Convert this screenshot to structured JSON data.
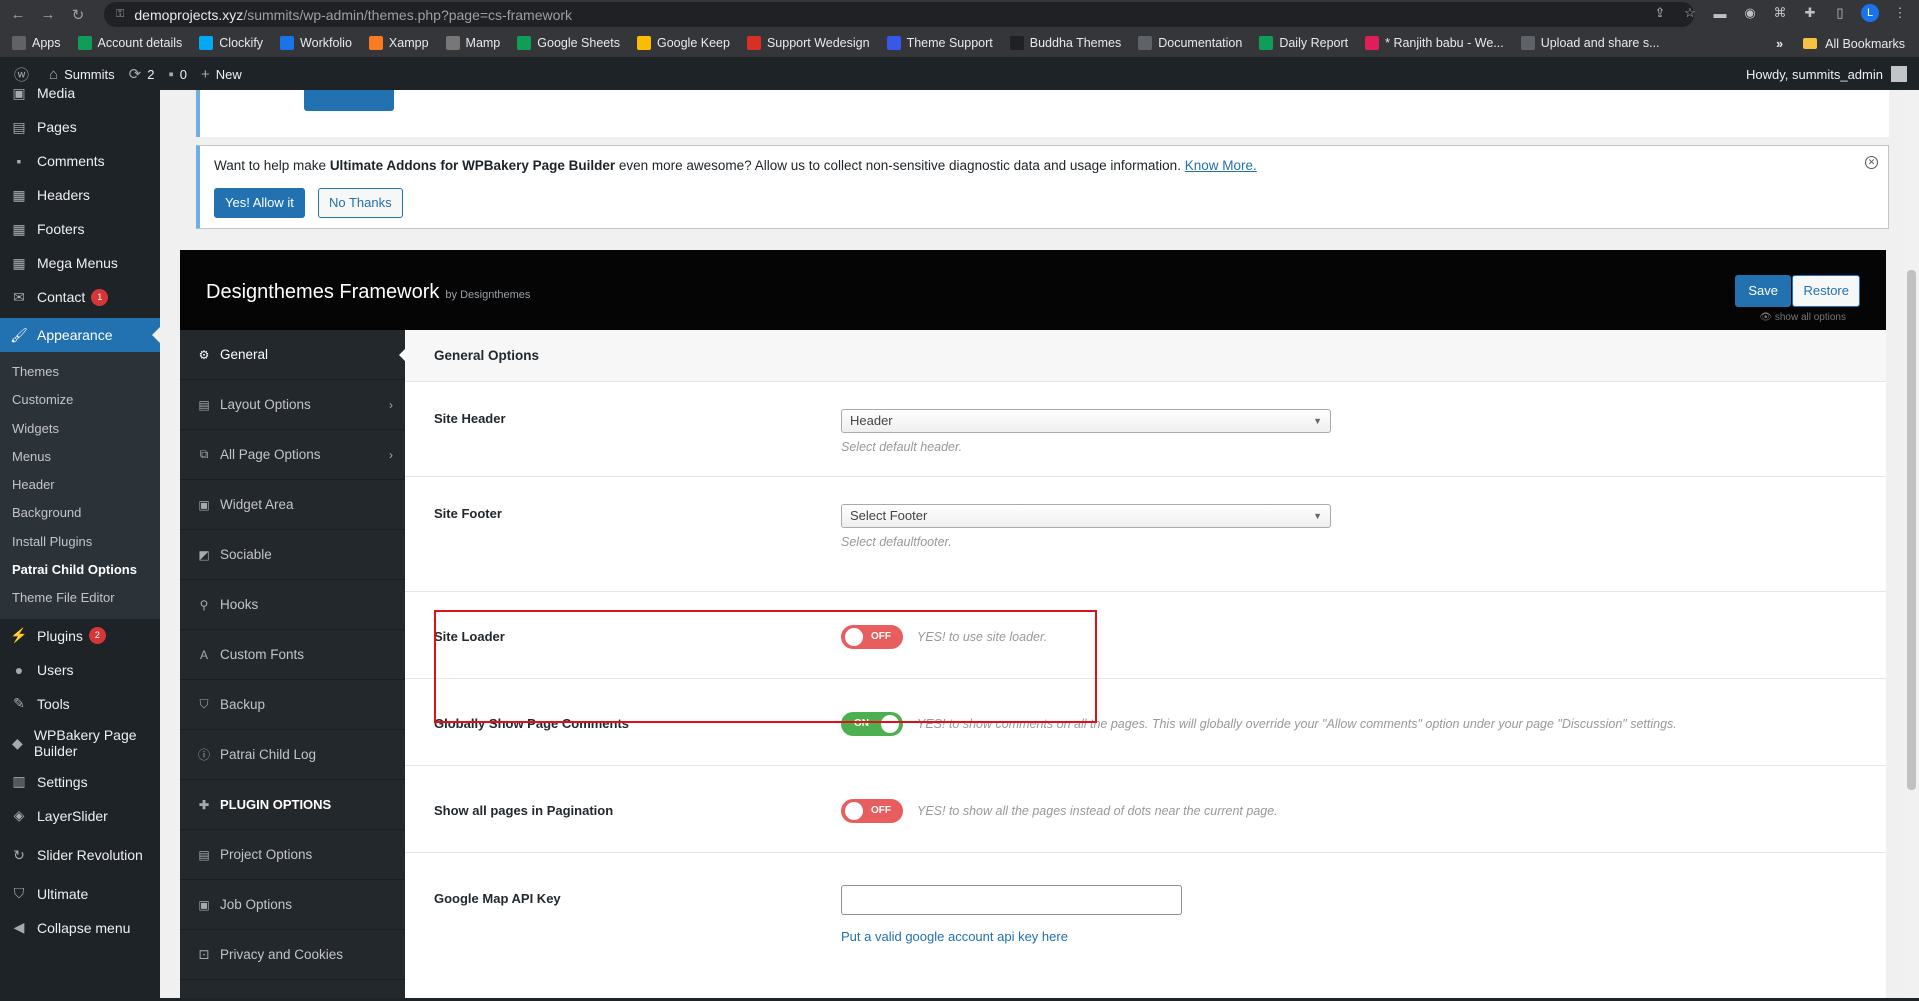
{
  "browser": {
    "url_host": "demoprojects.xyz",
    "url_path": "/summits/wp-admin/themes.php?page=cs-framework",
    "profile_initial": "L",
    "bookmarks": [
      {
        "label": "Apps",
        "color": "#5f6368"
      },
      {
        "label": "Account details",
        "color": "#0f9d58"
      },
      {
        "label": "Clockify",
        "color": "#03a9f4"
      },
      {
        "label": "Workfolio",
        "color": "#1a73e8"
      },
      {
        "label": "Xampp",
        "color": "#fb7a24"
      },
      {
        "label": "Mamp",
        "color": "#777777"
      },
      {
        "label": "Google Sheets",
        "color": "#0f9d58"
      },
      {
        "label": "Google Keep",
        "color": "#fbbc04"
      },
      {
        "label": "Support Wedesign",
        "color": "#d93025"
      },
      {
        "label": "Theme Support",
        "color": "#3858e9"
      },
      {
        "label": "Buddha Themes",
        "color": "#202124"
      },
      {
        "label": "Documentation",
        "color": "#5f6368"
      },
      {
        "label": "Daily Report",
        "color": "#0f9d58"
      },
      {
        "label": "* Ranjith babu - We...",
        "color": "#e01e5a"
      },
      {
        "label": "Upload and share s...",
        "color": "#5f6368"
      }
    ],
    "all_bookmarks": "All Bookmarks"
  },
  "adminbar": {
    "site": "Summits",
    "updates": "2",
    "comments": "0",
    "new": "New",
    "howdy": "Howdy, summits_admin"
  },
  "sidebar": {
    "items_top": [
      {
        "label": "Media",
        "icon": "media-icon"
      },
      {
        "label": "Pages",
        "icon": "pages-icon"
      },
      {
        "label": "Comments",
        "icon": "comments-icon"
      },
      {
        "label": "Headers",
        "icon": "grid-icon"
      },
      {
        "label": "Footers",
        "icon": "grid-icon"
      },
      {
        "label": "Mega Menus",
        "icon": "grid-icon"
      },
      {
        "label": "Contact",
        "icon": "mail-icon",
        "badge": "1"
      }
    ],
    "current": "Appearance",
    "submenu": [
      "Themes",
      "Customize",
      "Widgets",
      "Menus",
      "Header",
      "Background",
      "Install Plugins",
      "Patrai Child Options",
      "Theme File Editor"
    ],
    "submenu_active": "Patrai Child Options",
    "items_bottom": [
      {
        "label": "Plugins",
        "icon": "plugins-icon",
        "badge": "2"
      },
      {
        "label": "Users",
        "icon": "users-icon"
      },
      {
        "label": "Tools",
        "icon": "tools-icon"
      },
      {
        "label": "WPBakery Page Builder",
        "icon": "wpbakery-icon"
      },
      {
        "label": "Settings",
        "icon": "settings-icon"
      },
      {
        "label": "LayerSlider",
        "icon": "layers-icon"
      },
      {
        "label": "Slider Revolution",
        "icon": "refresh-icon"
      },
      {
        "label": "Ultimate",
        "icon": "shield-icon"
      },
      {
        "label": "Collapse menu",
        "icon": "collapse-icon"
      }
    ]
  },
  "notice": {
    "text_before": "Want to help make ",
    "text_bold": "Ultimate Addons for WPBakery Page Builder",
    "text_after": " even more awesome? Allow us to collect non-sensitive diagnostic data and usage information. ",
    "link": "Know More.",
    "allow": "Yes! Allow it",
    "deny": "No Thanks"
  },
  "framework": {
    "title": "Designthemes Framework",
    "by": "by Designthemes",
    "save": "Save",
    "restore": "Restore",
    "show_all": "show all options",
    "nav": [
      {
        "label": "General",
        "icon": "gears-icon",
        "active": true
      },
      {
        "label": "Layout Options",
        "icon": "layout-icon",
        "arrow": true
      },
      {
        "label": "All Page Options",
        "icon": "page-options-icon",
        "arrow": true
      },
      {
        "label": "Widget Area",
        "icon": "widget-icon"
      },
      {
        "label": "Sociable",
        "icon": "sociable-icon"
      },
      {
        "label": "Hooks",
        "icon": "hook-icon"
      },
      {
        "label": "Custom Fonts",
        "icon": "font-icon"
      },
      {
        "label": "Backup",
        "icon": "backup-icon"
      },
      {
        "label": "Patrai Child Log",
        "icon": "info-icon"
      }
    ],
    "plugin_section": "PLUGIN OPTIONS",
    "plugin_nav": [
      {
        "label": "Project Options",
        "icon": "project-icon"
      },
      {
        "label": "Job Options",
        "icon": "job-icon"
      },
      {
        "label": "Privacy and Cookies",
        "icon": "privacy-icon"
      }
    ],
    "section_title": "General Options",
    "fields": {
      "site_header": {
        "label": "Site Header",
        "value": "Header",
        "desc": "Select default header."
      },
      "site_footer": {
        "label": "Site Footer",
        "value": "Select Footer",
        "desc": "Select defaultfooter."
      },
      "site_loader": {
        "label": "Site Loader",
        "state": "OFF",
        "desc": "YES! to use site loader."
      },
      "page_comments": {
        "label": "Globally Show Page Comments",
        "state": "ON",
        "desc": "YES! to show comments on all the pages. This will globally override your \"Allow comments\" option under your page \"Discussion\" settings."
      },
      "pagination": {
        "label": "Show all pages in Pagination",
        "state": "OFF",
        "desc": "YES! to show all the pages instead of dots near the current page."
      },
      "map_api": {
        "label": "Google Map API Key",
        "value": "",
        "help": "Put a valid google account api key here"
      }
    }
  }
}
